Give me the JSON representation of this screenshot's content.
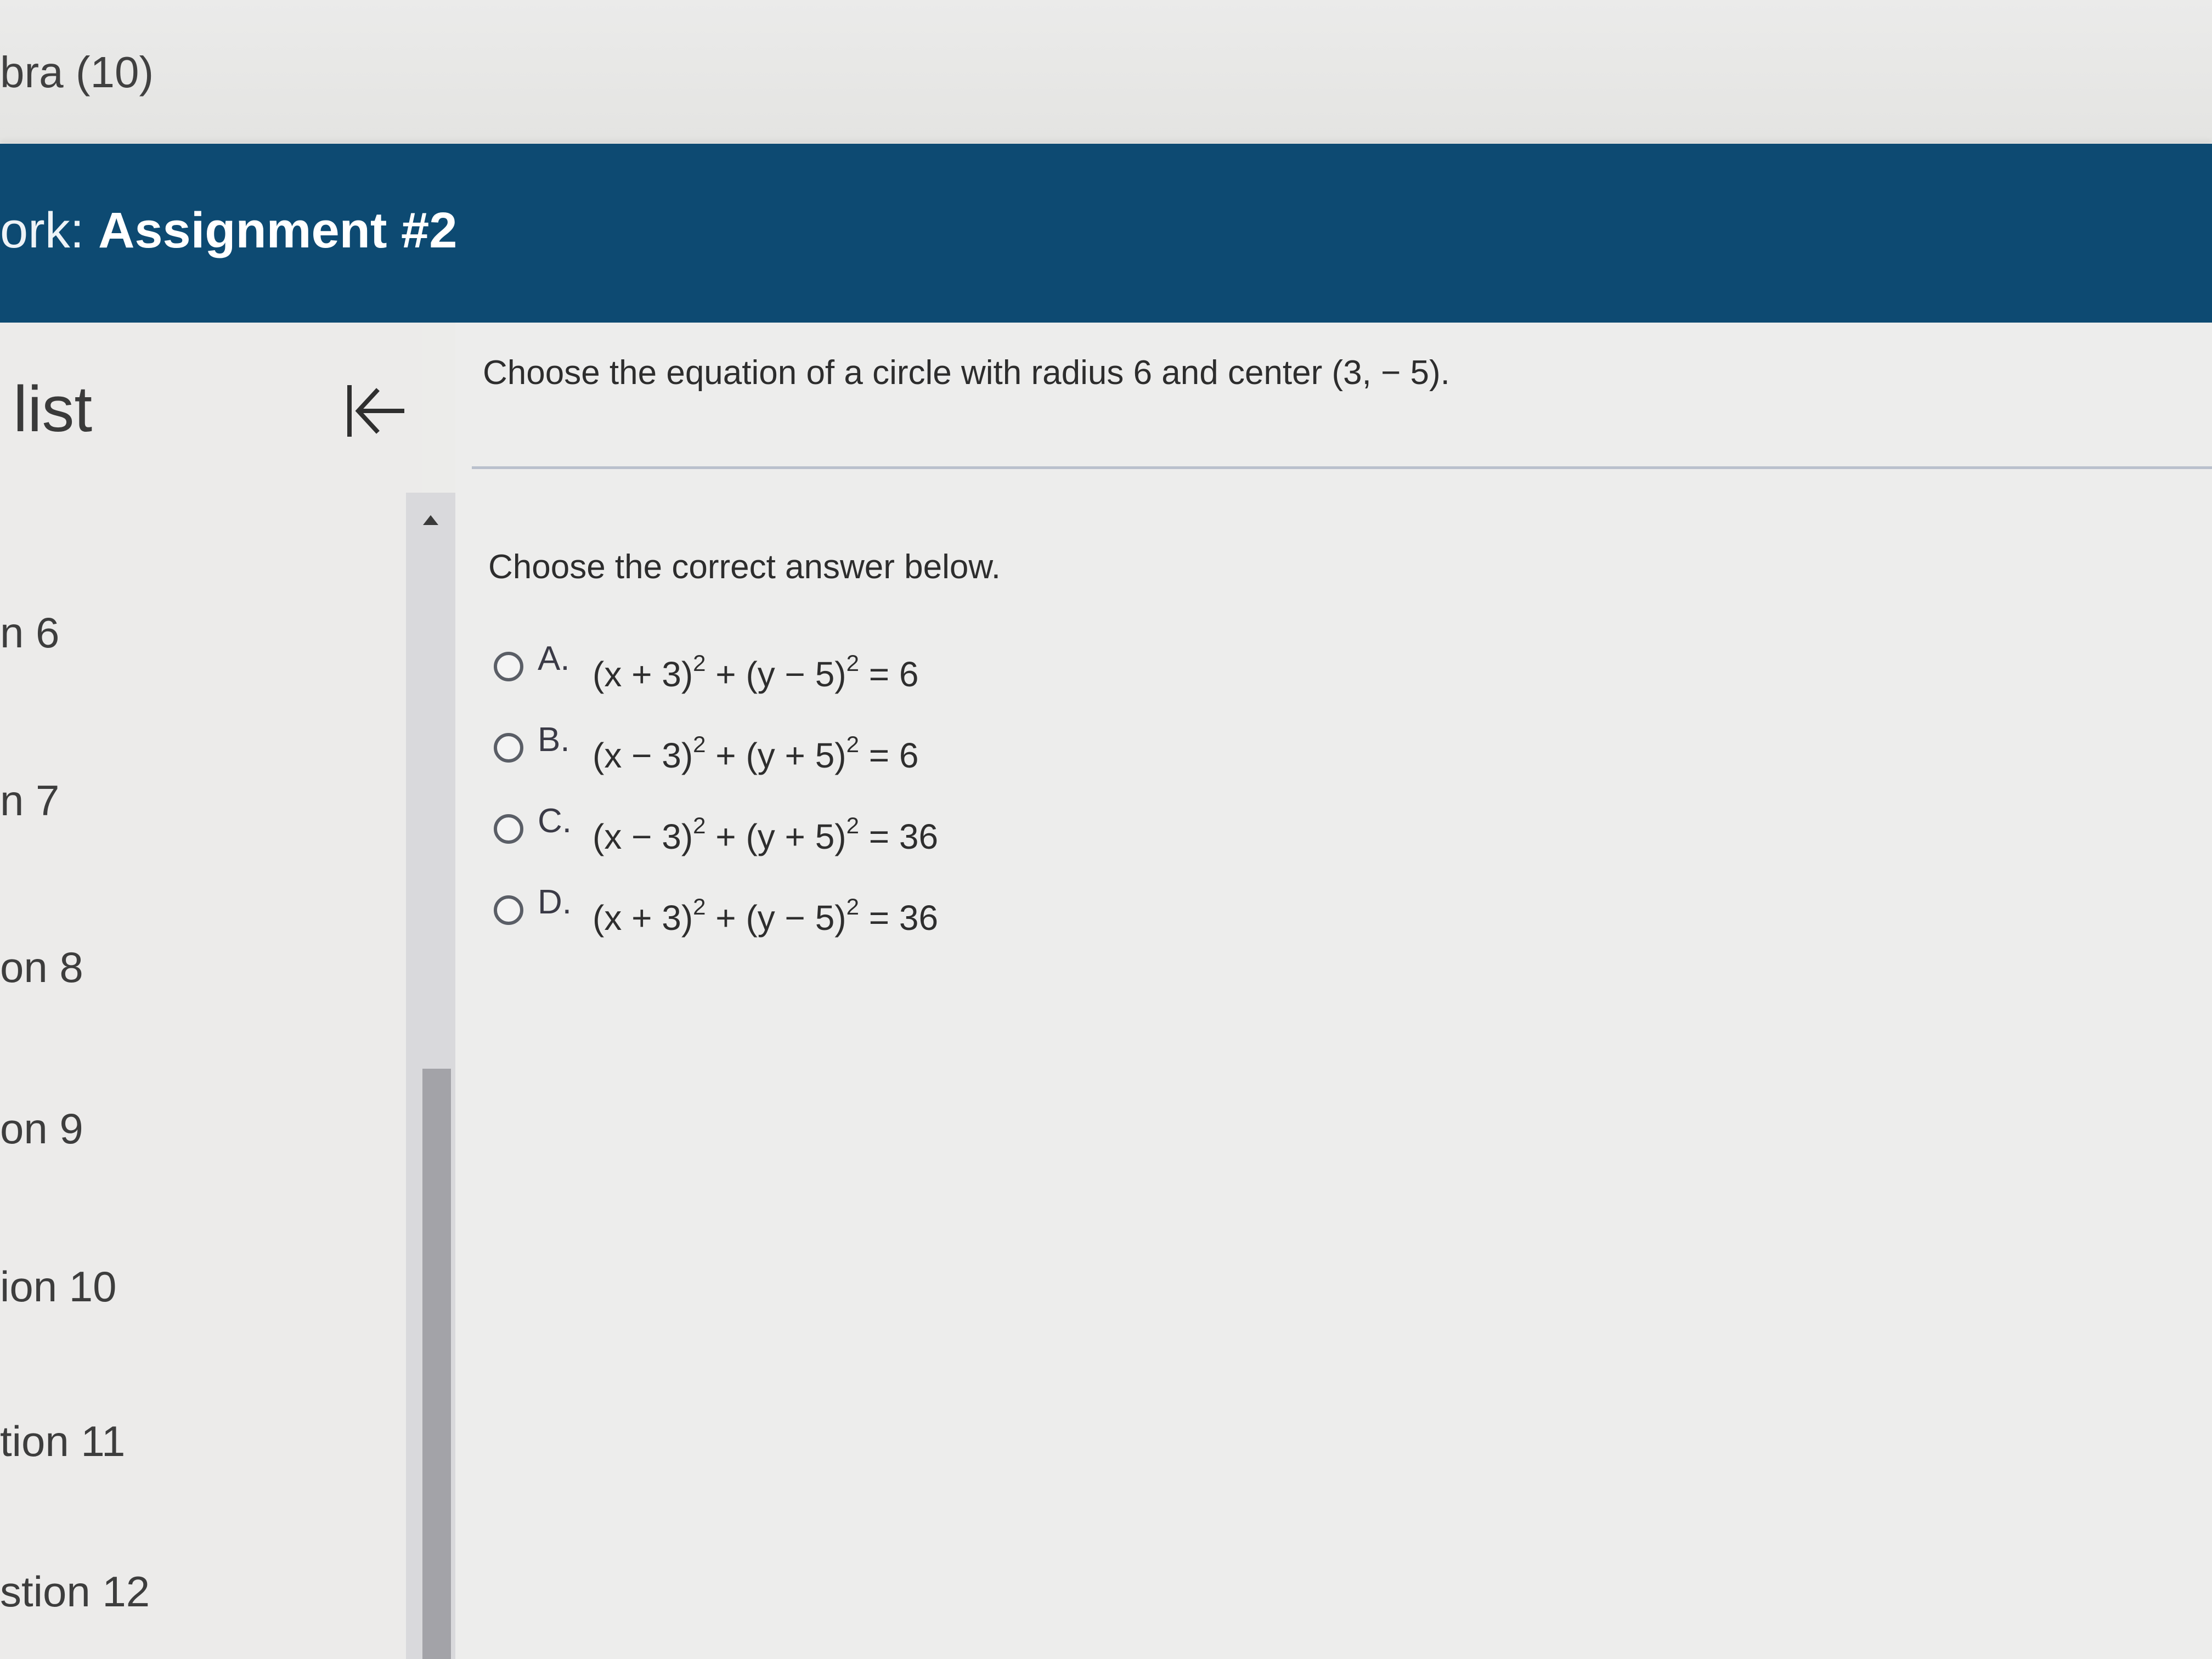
{
  "header": {
    "course": "bra (10)",
    "assignment_label": "ork:",
    "assignment_name": "Assignment #2"
  },
  "sidebar": {
    "heading": "list",
    "collapse_icon": "collapse-left-icon",
    "items": [
      {
        "label": "n 6"
      },
      {
        "label": "n 7"
      },
      {
        "label": "on 8"
      },
      {
        "label": "on 9"
      },
      {
        "label": "ion 10"
      },
      {
        "label": "tion 11"
      },
      {
        "label": "stion 12"
      }
    ]
  },
  "question": {
    "prompt": "Choose the equation of a circle with radius 6 and center (3, − 5).",
    "instruction": "Choose the correct answer below.",
    "options": [
      {
        "letter": "A.",
        "t1": "(x + 3)",
        "t2": " + (y − 5)",
        "t3": " = 6",
        "exp": "2"
      },
      {
        "letter": "B.",
        "t1": "(x − 3)",
        "t2": " + (y + 5)",
        "t3": " = 6",
        "exp": "2"
      },
      {
        "letter": "C.",
        "t1": "(x − 3)",
        "t2": " + (y + 5)",
        "t3": " = 36",
        "exp": "2"
      },
      {
        "letter": "D.",
        "t1": "(x + 3)",
        "t2": " + (y − 5)",
        "t3": " = 36",
        "exp": "2"
      }
    ]
  }
}
